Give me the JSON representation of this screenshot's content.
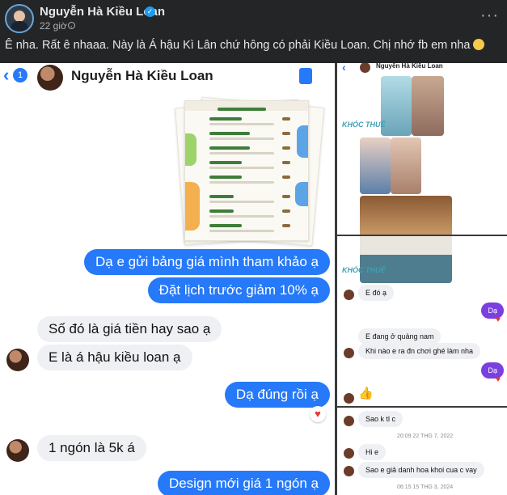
{
  "post": {
    "author": "Nguyễn Hà Kiều Loan",
    "time": "22 giờ ·",
    "caption": "Ê nha. Rất ê nhaaa. Này là Á hậu Kì Lân chứ hông có phải Kiều Loan. Chị nhớ fb em nha",
    "more_label": "···"
  },
  "chat_left": {
    "back_count": "1",
    "title": "Nguyễn Hà Kiều Loan",
    "messages": [
      {
        "dir": "out",
        "text": "Dạ e gửi bảng giá mình tham khảo ạ"
      },
      {
        "dir": "out",
        "text": "Đặt lịch trước giảm 10% ạ"
      },
      {
        "dir": "in",
        "text": "Số đó là giá tiền hay sao ạ"
      },
      {
        "dir": "in",
        "text": "E là á hậu kiều loan ạ"
      },
      {
        "dir": "out",
        "text": "Dạ đúng rồi ạ"
      },
      {
        "dir": "in",
        "text": "1 ngón là 5k á"
      },
      {
        "dir": "out",
        "text": "Design mới giá 1 ngón ạ"
      }
    ]
  },
  "chat_right_top": {
    "title": "Nguyễn Hà Kiều Loan",
    "watermark": "KHÓC THUÊ"
  },
  "chat_right_mid": {
    "watermark": "KHÓC THUÊ",
    "messages": [
      {
        "dir": "in",
        "text": "E đó ạ"
      },
      {
        "dir": "out",
        "text": "Dạ"
      },
      {
        "dir": "in",
        "text": "E đang ở quảng nam"
      },
      {
        "dir": "in",
        "text": "Khi nào e ra đn chơi ghé làm nha"
      },
      {
        "dir": "out",
        "text": "Dạ"
      }
    ]
  },
  "chat_right_bottom": {
    "messages": [
      {
        "dir": "in",
        "text": "Sao k tl c"
      },
      {
        "dir": "in",
        "text": "Hi e"
      },
      {
        "dir": "in",
        "text": "Sao e giả danh hoa khoi cua c vay"
      }
    ],
    "timestamps": [
      "20:09 22 THG 7, 2022",
      "06:15 15 THG 3, 2024"
    ]
  },
  "colors": {
    "messenger_blue": "#2679f8",
    "purple": "#7b3fe0",
    "fb_dark": "#242526"
  }
}
